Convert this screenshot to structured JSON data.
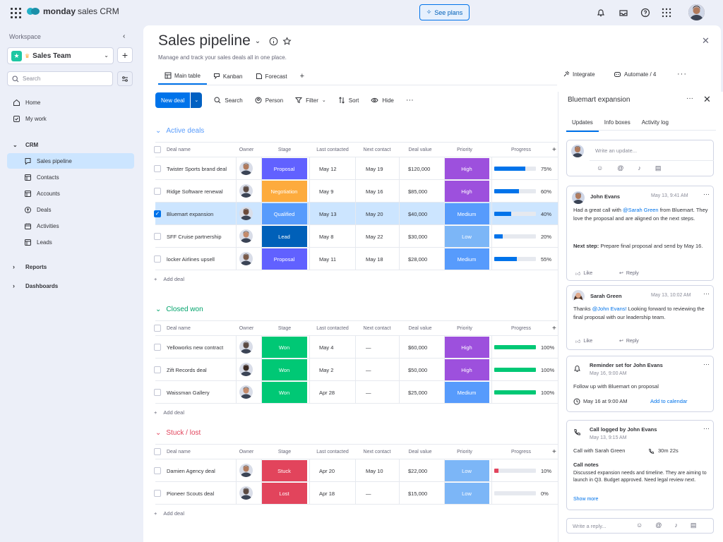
{
  "topbar": {
    "brand_bold": "monday",
    "brand_rest": "sales CRM",
    "see_plans": "See plans"
  },
  "sidebar": {
    "workspace_label": "Workspace",
    "workspace_name": "Sales Team",
    "search_placeholder": "Search",
    "items": [
      {
        "label": "Home",
        "icon": "home-icon"
      },
      {
        "label": "My work",
        "icon": "checkbox-icon"
      },
      {
        "label": "CRM",
        "icon": "chevron-down-icon"
      },
      {
        "label": "Sales pipeline",
        "icon": "board-icon"
      },
      {
        "label": "Contacts",
        "icon": "board-icon"
      },
      {
        "label": "Accounts",
        "icon": "board-icon"
      },
      {
        "label": "Deals",
        "icon": "deals-icon"
      },
      {
        "label": "Activities",
        "icon": "calendar-icon"
      },
      {
        "label": "Leads",
        "icon": "board-icon"
      },
      {
        "label": "Reports",
        "icon": "chevron-right-icon"
      },
      {
        "label": "Dashboards",
        "icon": "chevron-right-icon"
      }
    ]
  },
  "main": {
    "title": "Sales pipeline",
    "subtitle": "Manage and track your sales deals all in one place.",
    "tabs": [
      "Main table",
      "Kanban",
      "Forecast"
    ],
    "integrate": "Integrate",
    "automate": "Automate / 4",
    "toolbar": {
      "new_deal": "New deal",
      "search": "Search",
      "person": "Person",
      "filter": "Filter",
      "sort": "Sort",
      "hide": "Hide"
    },
    "columns": {
      "deal_name": "Deal name",
      "owner": "Owner",
      "stage": "Stage",
      "last_contacted": "Last contacted",
      "next_contact": "Next contact",
      "deal_value": "Deal value",
      "priority": "Priority",
      "progress": "Progress"
    },
    "add_deal": "Add deal",
    "groups": [
      {
        "name": "Active deals",
        "color": "#579bfc",
        "rows": [
          {
            "name": "Twister Sports brand deal",
            "stage": "Proposal",
            "stage_color": "#6161ff",
            "last": "May 12",
            "next": "May 19",
            "value": "$120,000",
            "priority": "High",
            "priority_color": "#9d50dd",
            "progress": "75%",
            "progress_value": 0.75,
            "bar_color": "#0073ea",
            "avatar": "#b07a5c",
            "selected": false
          },
          {
            "name": "Ridge Software renewal",
            "stage": "Negotiation",
            "stage_color": "#fdab3d",
            "last": "May 9",
            "next": "May 16",
            "value": "$85,000",
            "priority": "High",
            "priority_color": "#9d50dd",
            "progress": "60%",
            "progress_value": 0.6,
            "bar_color": "#0073ea",
            "avatar": "#5b4a42",
            "selected": false
          },
          {
            "name": "Bluemart expansion",
            "stage": "Qualified",
            "stage_color": "#579bfc",
            "last": "May 13",
            "next": "May 20",
            "value": "$40,000",
            "priority": "Medium",
            "priority_color": "#579bfc",
            "progress": "40%",
            "progress_value": 0.4,
            "bar_color": "#0073ea",
            "avatar": "#6b4a3a",
            "selected": true
          },
          {
            "name": "SFF Cruise partnership",
            "stage": "Lead",
            "stage_color": "#0060b9",
            "last": "May 8",
            "next": "May 22",
            "value": "$30,000",
            "priority": "Low",
            "priority_color": "#7cb6f7",
            "progress": "20%",
            "progress_value": 0.2,
            "bar_color": "#0073ea",
            "avatar": "#c48a6a",
            "selected": false
          },
          {
            "name": "locker Airlines upsell",
            "stage": "Proposal",
            "stage_color": "#6161ff",
            "last": "May 11",
            "next": "May 18",
            "value": "$28,000",
            "priority": "Medium",
            "priority_color": "#579bfc",
            "progress": "55%",
            "progress_value": 0.55,
            "bar_color": "#0073ea",
            "avatar": "#7a5a48",
            "selected": false
          }
        ]
      },
      {
        "name": "Closed won",
        "color": "#00a36b",
        "rows": [
          {
            "name": "Yelloworks new contract",
            "stage": "Won",
            "stage_color": "#00c875",
            "last": "May 4",
            "next": "—",
            "value": "$60,000",
            "priority": "High",
            "priority_color": "#9d50dd",
            "progress": "100%",
            "progress_value": 1.0,
            "bar_color": "#00c875",
            "avatar": "#5b4a42",
            "selected": false
          },
          {
            "name": "Zift Records deal",
            "stage": "Won",
            "stage_color": "#00c875",
            "last": "May 2",
            "next": "—",
            "value": "$50,000",
            "priority": "High",
            "priority_color": "#9d50dd",
            "progress": "100%",
            "progress_value": 1.0,
            "bar_color": "#00c875",
            "avatar": "#3b2a22",
            "selected": false
          },
          {
            "name": "Waissman Gallery",
            "stage": "Won",
            "stage_color": "#00c875",
            "last": "Apr 28",
            "next": "—",
            "value": "$25,000",
            "priority": "Medium",
            "priority_color": "#579bfc",
            "progress": "100%",
            "progress_value": 1.0,
            "bar_color": "#00c875",
            "avatar": "#c48a6a",
            "selected": false
          }
        ]
      },
      {
        "name": "Stuck / lost",
        "color": "#e2445c",
        "rows": [
          {
            "name": "Damien Agency deal",
            "stage": "Stuck",
            "stage_color": "#e2445c",
            "last": "Apr 20",
            "next": "May 10",
            "value": "$22,000",
            "priority": "Low",
            "priority_color": "#7cb6f7",
            "progress": "10%",
            "progress_value": 0.1,
            "bar_color": "#e2445c",
            "avatar": "#b07a5c",
            "selected": false
          },
          {
            "name": "Pioneer Scouts deal",
            "stage": "Lost",
            "stage_color": "#e2445c",
            "last": "Apr 18",
            "next": "—",
            "value": "$15,000",
            "priority": "Low",
            "priority_color": "#7cb6f7",
            "progress": "0%",
            "progress_value": 0,
            "bar_color": "#e2445c",
            "avatar": "#5b4a42",
            "selected": false
          }
        ]
      }
    ]
  },
  "panel": {
    "title": "Bluemart expansion",
    "tabs": [
      "Updates",
      "Info boxes",
      "Activity log"
    ],
    "update_placeholder": "Write an update...",
    "update1": {
      "author": "John Evans",
      "time": "May 13, 9:41 AM",
      "text_a": "Had a great call with ",
      "mention": "@Sarah Green",
      "text_b": " from Bluemart. They love the proposal and are aligned on the next steps.",
      "next_step_label": "Next step:",
      "next_step": " Prepare final proposal and send by May 16.",
      "like": "Like",
      "reply": "Reply"
    },
    "update2": {
      "author": "Sarah Green",
      "time": "May 13, 10:02 AM",
      "text_a": "Thanks ",
      "mention": "@John Evans!",
      "text_b": " Looking forward to reviewing the final proposal with our leadership team.",
      "like": "Like",
      "reply": "Reply"
    },
    "reminder": {
      "title": "Reminder set for John Evans",
      "time": "May 16, 9:00 AM",
      "text": "Follow up with Bluemart on proposal",
      "date": "May 16 at 9:00 AM",
      "add_calendar": "Add to calendar"
    },
    "call": {
      "title": "Call logged by John Evans",
      "time": "May 13, 9:15 AM",
      "with": "Call with Sarah Green",
      "duration": "30m 22s",
      "notes_label": "Call notes",
      "notes": "Discussed expansion needs and timeline. They are aiming to launch in Q3. Budget approved. Need legal review next.",
      "show_more": "Show more"
    },
    "reply_placeholder": "Write a reply..."
  }
}
